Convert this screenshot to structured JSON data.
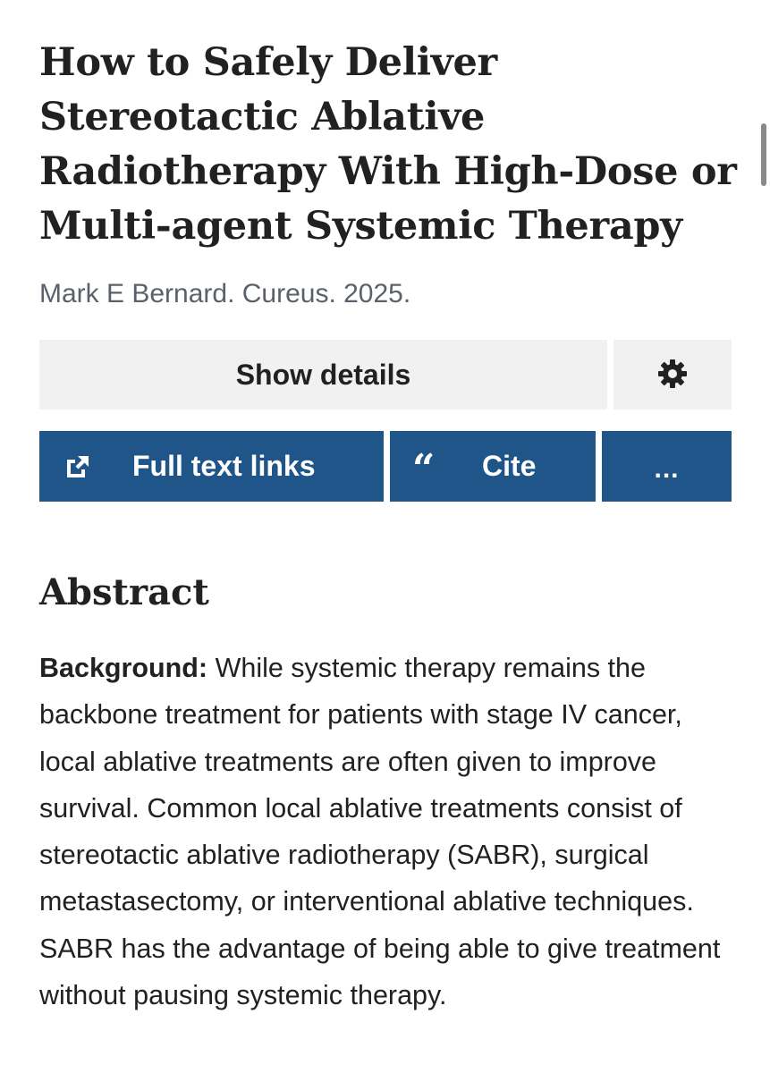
{
  "article": {
    "title": "How to Safely Deliver Stereotactic Ablative Radiotherapy With High-Dose or Multi-agent Systemic Therapy",
    "citation": "Mark E Bernard. Cureus. 2025."
  },
  "actions": {
    "show_details_label": "Show details",
    "settings_icon": "gear-icon",
    "full_text_links_label": "Full text links",
    "full_text_icon": "external-link-icon",
    "cite_label": "Cite",
    "cite_icon_glyph": "“",
    "more_label": "..."
  },
  "abstract": {
    "heading": "Abstract",
    "background_label": "Background:",
    "background_text": " While systemic therapy remains the backbone treatment for patients with stage IV cancer, local ablative treatments are often given to improve survival. Common local ablative treatments consist of stereotactic ablative radiotherapy (SABR), surgical metastasectomy, or interventional ablative techniques. SABR has the advantage of being able to give treatment without pausing systemic therapy."
  },
  "colors": {
    "primary_button": "#20558a",
    "secondary_button": "#f1f1f1",
    "text": "#212121",
    "citation_text": "#5b616b"
  }
}
